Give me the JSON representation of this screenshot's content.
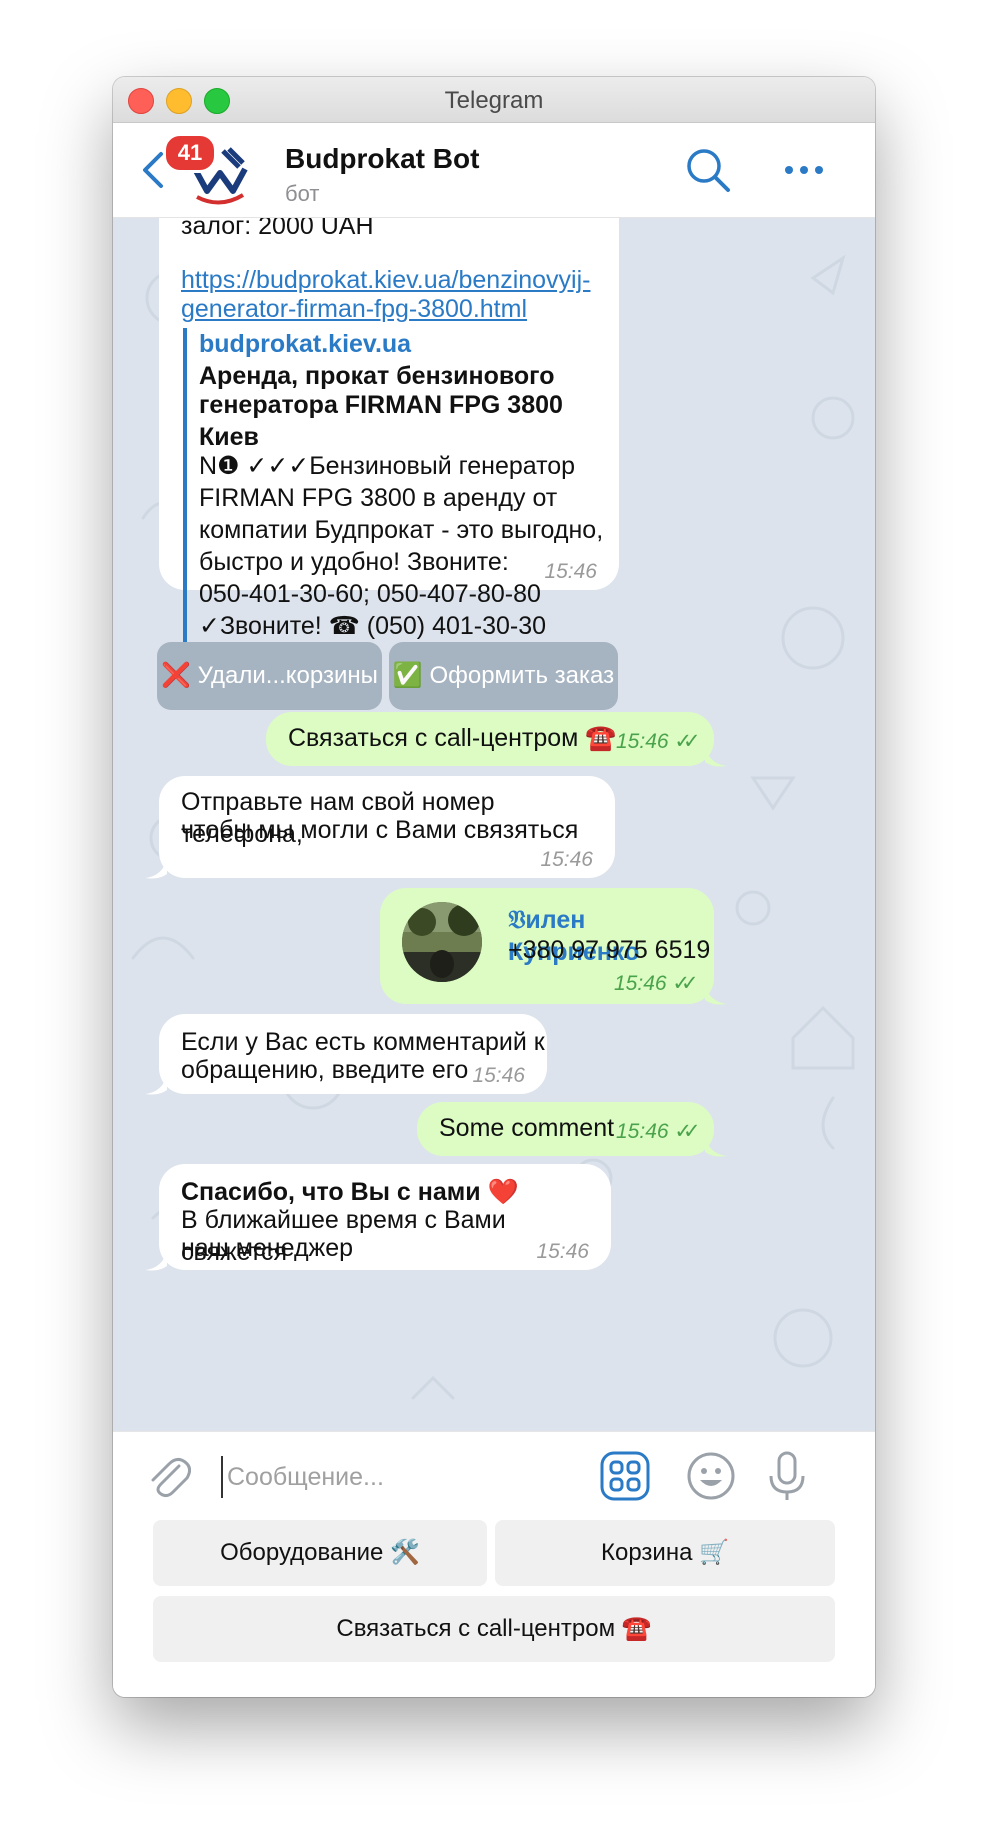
{
  "window": {
    "title": "Telegram"
  },
  "header": {
    "unread_count": "41",
    "chat_name": "Budprokat Bot",
    "chat_status": "бот"
  },
  "messages": {
    "product": {
      "deposit_line": "залог: 2000 UAH",
      "link_line1": "https://budprokat.kiev.ua/benzinovyij-",
      "link_line2": "generator-firman-fpg-3800.html",
      "preview_site": "budprokat.kiev.ua",
      "preview_title_1": "Аренда, прокат бензинового",
      "preview_title_2": "генератора FIRMAN FPG 3800 Киев",
      "preview_desc_1": "N❶ ✓✓✓Бензиновый генератор",
      "preview_desc_2": "FIRMAN FPG 3800 в аренду от",
      "preview_desc_3": "компатии Будпрокат - это выгодно,",
      "preview_desc_4": "быстро и удобно! Звоните:",
      "preview_desc_5": "050-401-30-60; 050-407-80-80",
      "preview_desc_6": "✓Звоните! ☎ (050) 401-30-30",
      "time": "15:46"
    },
    "inline_buttons": {
      "delete": "❌ Удали...корзины",
      "checkout": "✅ Оформить заказ"
    },
    "out_call": {
      "text": "Связаться с call-центром ☎️",
      "time": "15:46",
      "check": "✓✓"
    },
    "in_phone": {
      "line1": "Отправьте нам свой номер телефона,",
      "line2": "чтобы мы могли с Вами связяться",
      "time": "15:46"
    },
    "out_contact": {
      "name": "𝔙илен Куприенко",
      "phone": "+380 97 975 6519",
      "time": "15:46",
      "check": "✓✓"
    },
    "in_comment": {
      "line1": "Если у Вас есть комментарий к",
      "line2": "обращению, введите его",
      "time": "15:46"
    },
    "out_comment": {
      "text": "Some comment",
      "time": "15:46",
      "check": "✓✓"
    },
    "in_thanks": {
      "line1": "Спасибо, что Вы с нами ❤️",
      "line2": "В ближайшее время с Вами свяжется",
      "line3": "наш менеджер",
      "time": "15:46"
    }
  },
  "composer": {
    "placeholder": "Сообщение..."
  },
  "reply_keyboard": {
    "equipment": "Оборудование 🛠️",
    "cart": "Корзина 🛒",
    "call_center": "Связаться с call-центром ☎️"
  },
  "colors": {
    "accent": "#2a7ac6",
    "incoming_bubble": "#ffffff",
    "outgoing_bubble": "#dcfcc4",
    "chat_background": "#dce3ec",
    "badge": "#e53935"
  }
}
